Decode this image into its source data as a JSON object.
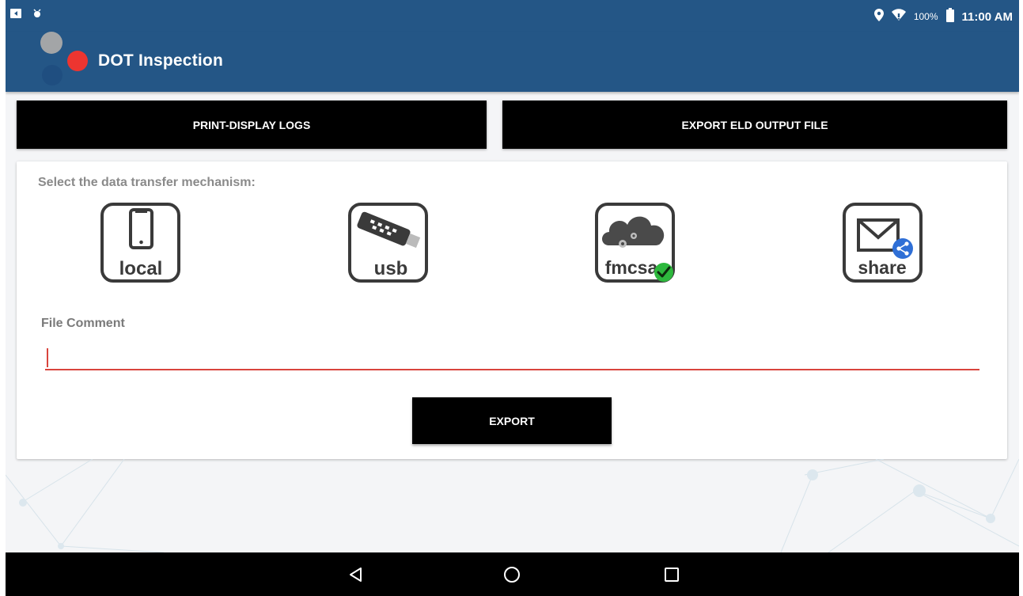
{
  "status_bar": {
    "battery_percent": "100%",
    "time": "11:00 AM",
    "icons": [
      "notification-icon",
      "alarm-icon",
      "location-icon",
      "wifi-icon",
      "battery-icon"
    ]
  },
  "app_bar": {
    "title": "DOT Inspection",
    "colors": {
      "bar": "#245686",
      "logo_gray": "#a3a5a7",
      "logo_red": "#ed3530",
      "logo_blue": "#1f4e80"
    }
  },
  "actions": {
    "print_display_logs": "PRINT-DISPLAY LOGS",
    "export_eld_output_file": "EXPORT ELD OUTPUT FILE"
  },
  "transfer": {
    "prompt": "Select the data transfer mechanism:",
    "options": [
      {
        "label": "local",
        "icon": "phone-icon"
      },
      {
        "label": "usb",
        "icon": "usb-drive-icon"
      },
      {
        "label": "fmcsa",
        "icon": "cloud-icon",
        "selected": true
      },
      {
        "label": "share",
        "icon": "envelope-share-icon"
      }
    ]
  },
  "comment": {
    "label": "File Comment",
    "value": "",
    "accent": "#d9443d"
  },
  "export_button": "EXPORT",
  "nav_bar": [
    "back-icon",
    "home-icon",
    "recent-apps-icon"
  ]
}
